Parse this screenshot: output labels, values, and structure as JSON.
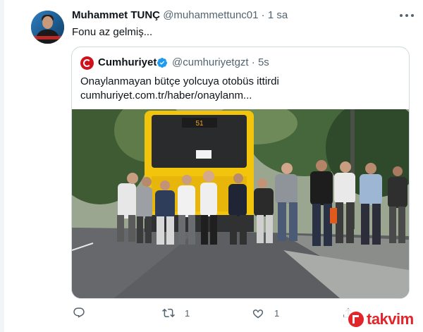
{
  "tweet": {
    "author_name": "Muhammet TUNÇ",
    "author_handle": "@muhammettunc01",
    "separator": "·",
    "time": "1 sa",
    "text": "Fonu az gelmiş..."
  },
  "quoted_tweet": {
    "name": "Cumhuriyet",
    "handle": "@cumhuriyetgzt",
    "separator": "·",
    "time": "5s",
    "text_line1": "Onaylanmayan bütçe yolcuya otobüs ittirdi",
    "text_line2": "cumhuriyet.com.tr/haber/onaylanm...",
    "logo_color": "#d0101b",
    "verified_color": "#1d9bf0",
    "media": {
      "bus_color": "#f2c40c",
      "bus_route_number": "51"
    }
  },
  "actions": {
    "reply_icon": "reply-icon",
    "retweet_icon": "retweet-icon",
    "retweet_count": "1",
    "like_icon": "heart-icon",
    "like_count": "1",
    "share_icon": "share-icon"
  },
  "watermark": {
    "text": "takvim",
    "color": "#e2242b"
  }
}
